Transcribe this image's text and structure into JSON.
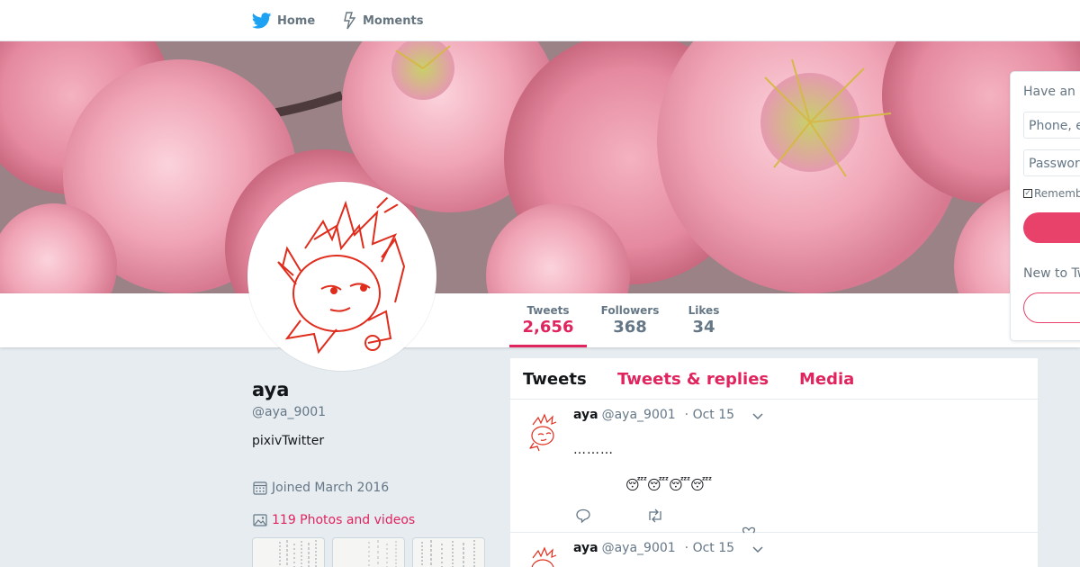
{
  "nav": {
    "home_label": "Home",
    "moments_label": "Moments"
  },
  "profile": {
    "name": "aya",
    "handle": "@aya_9001",
    "bio": "pixivTwitter",
    "joined": "Joined March 2016",
    "photos_label": "119 Photos and videos"
  },
  "stats": {
    "tweets_label": "Tweets",
    "tweets_value": "2,656",
    "followers_label": "Followers",
    "followers_value": "368",
    "likes_label": "Likes",
    "likes_value": "34"
  },
  "timeline_tabs": {
    "tweets": "Tweets",
    "replies": "Tweets & replies",
    "media": "Media"
  },
  "tweets": [
    {
      "name": "aya",
      "handle": "@aya_9001",
      "date": "· Oct 15",
      "text": "………",
      "emoji": "😴😴😴😴"
    },
    {
      "name": "aya",
      "handle": "@aya_9001",
      "date": "· Oct 15"
    }
  ],
  "login": {
    "title": "Have an account?",
    "phone_placeholder": "Phone, email or username",
    "password_placeholder": "Password",
    "remember": "Remember me",
    "new_prompt": "New to Twitter?"
  },
  "colors": {
    "accent": "#e0245e",
    "background": "#e6ecf0",
    "twitter_blue": "#1da1f2"
  }
}
